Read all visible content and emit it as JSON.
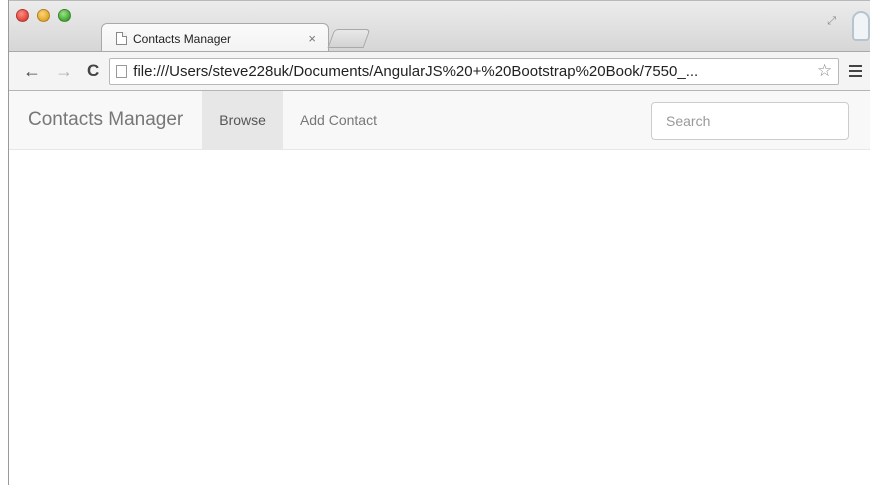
{
  "browser": {
    "tab_title": "Contacts Manager",
    "tab_close": "×",
    "url": "file:///Users/steve228uk/Documents/AngularJS%20+%20Bootstrap%20Book/7550_...",
    "icons": {
      "back": "←",
      "forward": "→",
      "reload": "C",
      "star": "☆",
      "fullscreen": "⤢"
    }
  },
  "navbar": {
    "brand": "Contacts Manager",
    "links": [
      {
        "label": "Browse",
        "active": true
      },
      {
        "label": "Add Contact",
        "active": false
      }
    ],
    "search": {
      "placeholder": "Search",
      "value": ""
    }
  }
}
